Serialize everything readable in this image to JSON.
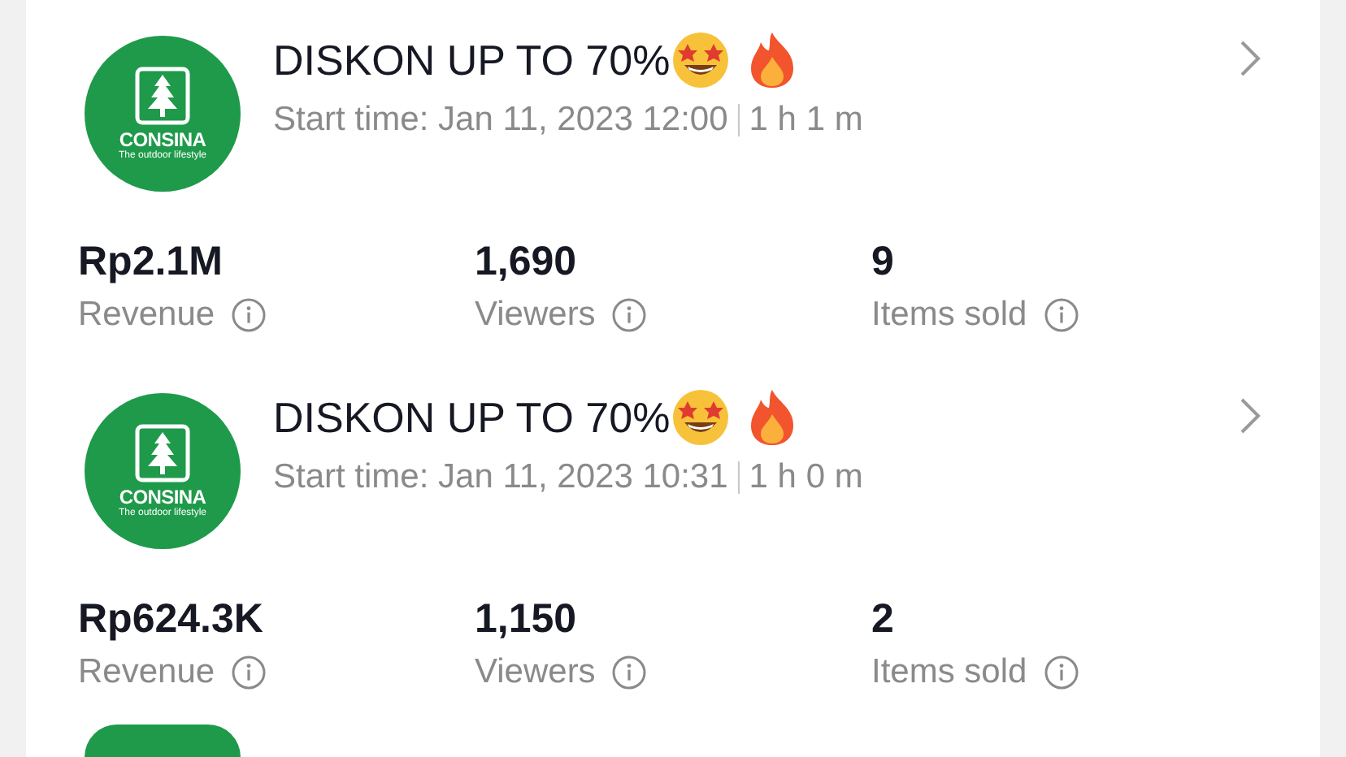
{
  "sessions": [
    {
      "logo": {
        "brand": "CONSINA",
        "tagline": "The outdoor lifestyle"
      },
      "title": "DISKON UP TO 70%",
      "start_time": "Start time: Jan 11, 2023 12:00",
      "duration": "1 h 1 m",
      "stats": [
        {
          "value": "Rp2.1M",
          "label": "Revenue"
        },
        {
          "value": "1,690",
          "label": "Viewers"
        },
        {
          "value": "9",
          "label": "Items sold"
        }
      ]
    },
    {
      "logo": {
        "brand": "CONSINA",
        "tagline": "The outdoor lifestyle"
      },
      "title": "DISKON UP TO 70%",
      "start_time": "Start time: Jan 11, 2023 10:31",
      "duration": "1 h 0 m",
      "stats": [
        {
          "value": "Rp624.3K",
          "label": "Revenue"
        },
        {
          "value": "1,150",
          "label": "Viewers"
        },
        {
          "value": "2",
          "label": "Items sold"
        }
      ]
    }
  ]
}
